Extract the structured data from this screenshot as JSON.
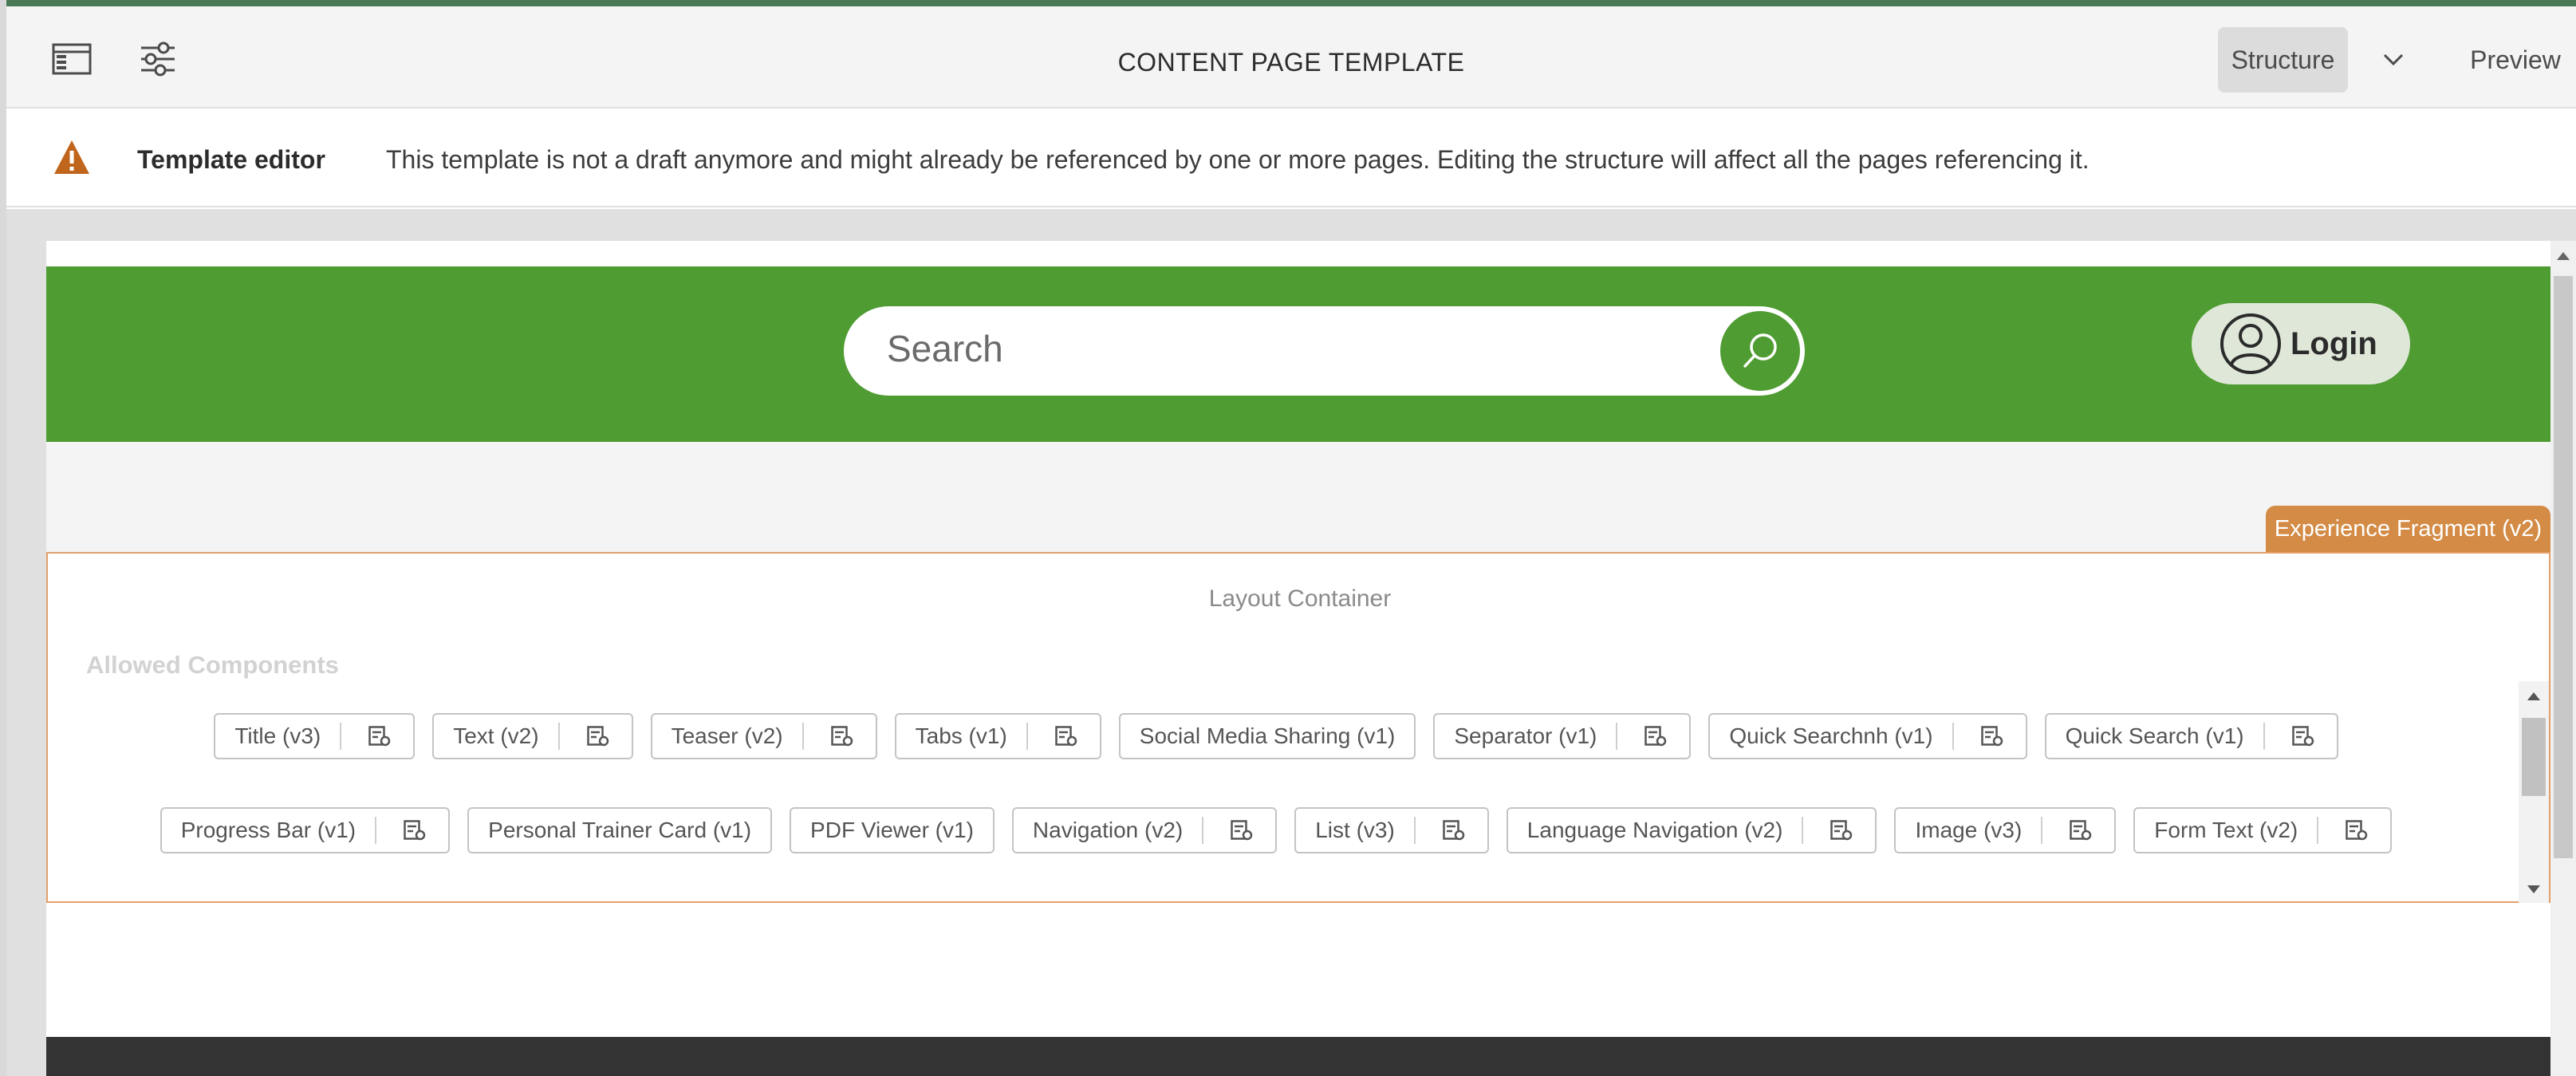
{
  "header": {
    "title": "CONTENT PAGE TEMPLATE",
    "modes": {
      "structure": "Structure",
      "preview": "Preview"
    }
  },
  "alert": {
    "title": "Template editor",
    "message": "This template is not a draft anymore and might already be referenced by one or more pages. Editing the structure will affect all the pages referencing it."
  },
  "site_header": {
    "search_placeholder": "Search",
    "login_label": "Login",
    "brand_color": "#4f9c33"
  },
  "experience_fragment": {
    "tag": "Experience Fragment (v2)"
  },
  "layout_container": {
    "label": "Layout Container",
    "allowed_label": "Allowed Components",
    "row1": [
      "Title (v3)",
      "Text (v2)",
      "Teaser (v2)",
      "Tabs (v1)",
      "Social Media Sharing (v1)",
      "Separator (v1)",
      "Quick Searchnh (v1)",
      "Quick Search (v1)"
    ],
    "row2": [
      "Progress Bar (v1)",
      "Personal Trainer Card (v1)",
      "PDF Viewer (v1)",
      "Navigation (v2)",
      "List (v3)",
      "Language Navigation (v2)",
      "Image (v3)",
      "Form Text (v2)"
    ]
  },
  "colors": {
    "accent_orange": "#d38b45",
    "warning": "#c0651c"
  }
}
